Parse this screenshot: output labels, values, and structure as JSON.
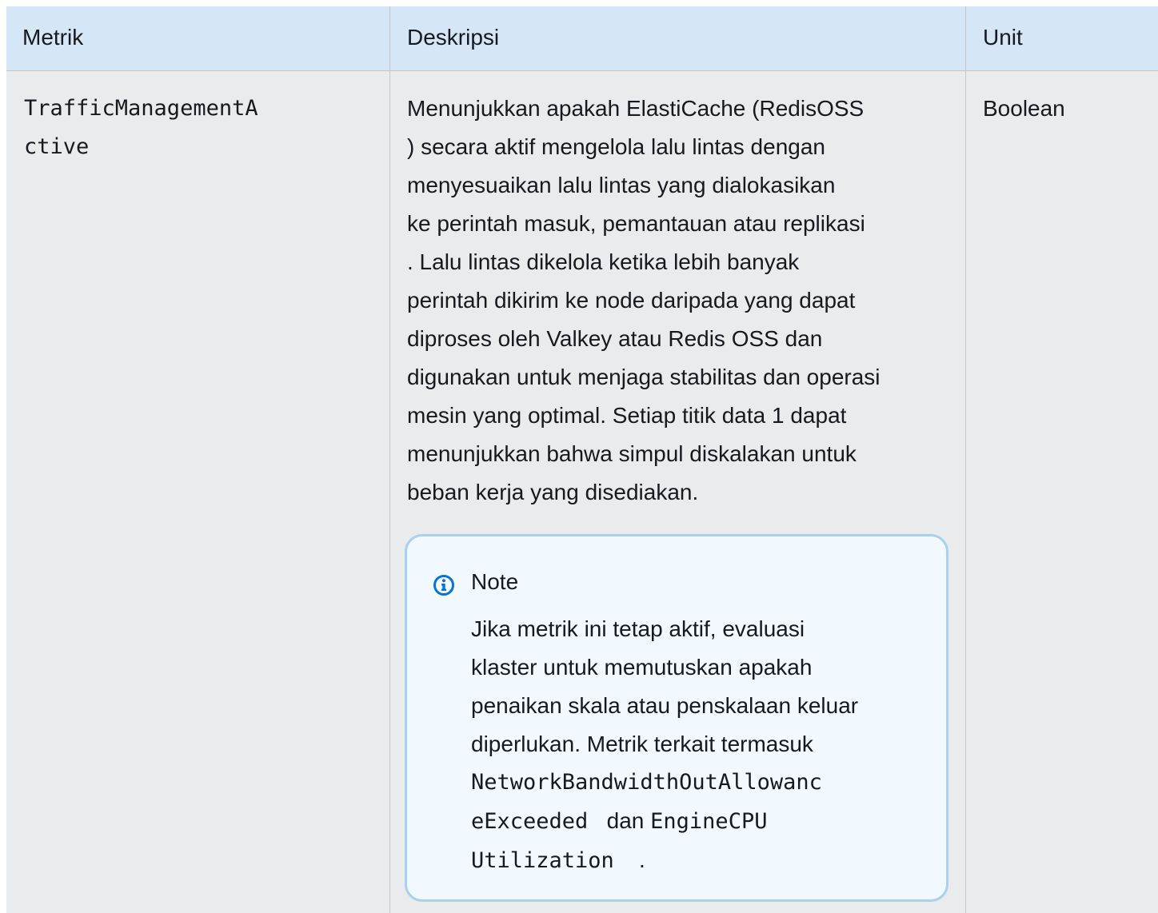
{
  "table": {
    "headers": {
      "metric": "Metrik",
      "description": "Deskripsi",
      "unit": "Unit"
    },
    "rows": [
      {
        "metric_lines": [
          "TrafficManagementA",
          "ctive"
        ],
        "description_lines": [
          "Menunjukkan apakah ElastiCache (RedisOSS",
          ") secara aktif mengelola lalu lintas dengan",
          "menyesuaikan lalu lintas yang dialokasikan",
          "ke perintah masuk, pemantauan atau replikasi",
          ". Lalu lintas dikelola ketika lebih banyak",
          "perintah dikirim ke node daripada yang dapat",
          "diproses oleh Valkey atau Redis OSS dan",
          "digunakan untuk menjaga stabilitas dan operasi",
          "mesin yang optimal. Setiap titik data 1 dapat",
          "menunjukkan bahwa simpul diskalakan untuk",
          "beban kerja yang disediakan."
        ],
        "unit": "Boolean",
        "note": {
          "icon": "info-icon",
          "title": "Note",
          "lines": [
            "Jika metrik ini tetap aktif, evaluasi",
            "klaster untuk memutuskan apakah",
            "penaikan skala atau penskalaan keluar",
            "diperlukan. Metrik terkait termasuk"
          ],
          "code_line_1": "NetworkBandwidthOutAllowanc",
          "code_line_2": "eExceeded",
          "connector": "dan",
          "code_line_3": "EngineCPU",
          "code_line_4": "Utilization",
          "end_punct": "."
        }
      }
    ]
  },
  "colors": {
    "header_bg": "#d5e6f7",
    "row_bg": "#e9ebed",
    "note_border": "#a8d0ef",
    "note_bg": "#f1f8fe",
    "info_icon": "#0972d3"
  }
}
